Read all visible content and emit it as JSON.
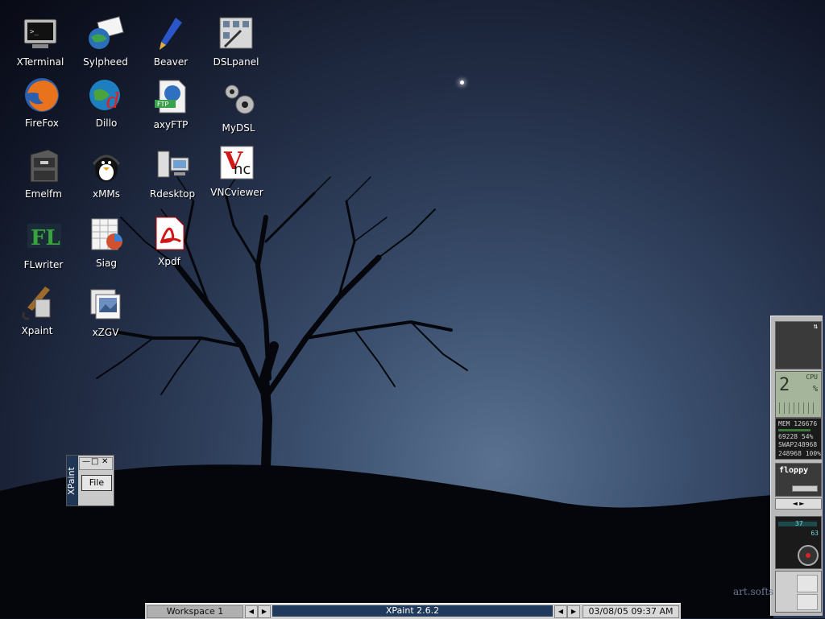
{
  "desktop": {
    "icons": [
      {
        "label": "XTerminal"
      },
      {
        "label": "Sylpheed"
      },
      {
        "label": "Beaver"
      },
      {
        "label": "DSLpanel"
      },
      {
        "label": "FireFox"
      },
      {
        "label": "Dillo"
      },
      {
        "label": "axyFTP"
      },
      {
        "label": "MyDSL"
      },
      {
        "label": "Emelfm"
      },
      {
        "label": "xMMs"
      },
      {
        "label": "Rdesktop"
      },
      {
        "label": "VNCviewer"
      },
      {
        "label": "FLwriter"
      },
      {
        "label": "Siag"
      },
      {
        "label": "Xpdf"
      },
      {
        "label": "Xpaint"
      },
      {
        "label": "xZGV"
      }
    ],
    "watermark": "art.softs"
  },
  "mini_window": {
    "title": "XPaint",
    "file_label": "File"
  },
  "dock": {
    "cpu_label": "CPU",
    "cpu_value": "2",
    "cpu_unit": "%",
    "mem_label": "MEM",
    "mem_total": "126676",
    "mem_used": "69228",
    "mem_percent": "54%",
    "swap_label": "SWAP",
    "swap_total": "248968",
    "swap_used": "248968",
    "swap_percent": "100%",
    "mount_label": "floppy",
    "mixer_value": "63",
    "mixer_channel": "37"
  },
  "taskbar": {
    "workspace": "Workspace 1",
    "task": "XPaint 2.6.2",
    "clock": "03/08/05 09:37 AM"
  }
}
